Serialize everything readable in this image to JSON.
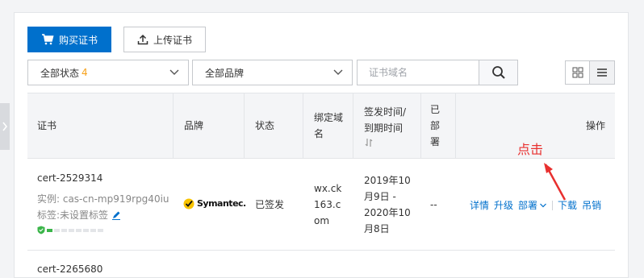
{
  "toolbar": {
    "buy_label": "购买证书",
    "upload_label": "上传证书"
  },
  "filters": {
    "status_label": "全部状态",
    "status_count": "4",
    "brand_label": "全部品牌",
    "search_placeholder": "证书域名"
  },
  "table": {
    "headers": {
      "cert": "证书",
      "brand": "品牌",
      "status": "状态",
      "domain": "绑定域名",
      "time": "签发时间/到期时间",
      "deployed": "已部署",
      "actions": "操作"
    },
    "rows": [
      {
        "name": "cert-2529314",
        "instance": "实例: cas-cn-mp919rpg40iu",
        "tag": "标签:未设置标签",
        "brand": "Symantec.",
        "status": "已签发",
        "domain": "wx.ck163.com",
        "issue_date": "2019年10月9日 -",
        "expiry_date": "2020年10月8日",
        "deployed": "--",
        "actions": {
          "detail": "详情",
          "upgrade": "升级",
          "deploy": "部署",
          "download": "下载",
          "revoke": "吊销"
        }
      },
      {
        "name": "cert-2265680"
      }
    ]
  },
  "annotation": {
    "text": "点击",
    "color": "#e8302f"
  },
  "colors": {
    "primary": "#0070cc",
    "accent_orange": "#f7a11a",
    "security_green": "#3bb54a"
  }
}
